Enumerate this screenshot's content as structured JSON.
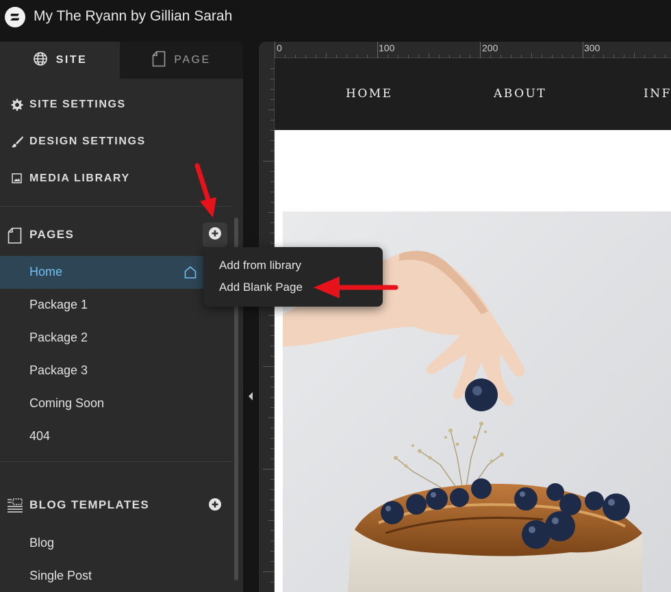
{
  "app": {
    "site_title": "My The Ryann by Gillian Sarah"
  },
  "sidebar": {
    "tabs": [
      {
        "label": "SITE",
        "icon": "globe-icon",
        "active": true
      },
      {
        "label": "PAGE",
        "icon": "page-icon",
        "active": false
      }
    ],
    "menu": [
      {
        "label": "SITE SETTINGS",
        "icon": "gear-icon"
      },
      {
        "label": "DESIGN SETTINGS",
        "icon": "brush-icon"
      },
      {
        "label": "MEDIA LIBRARY",
        "icon": "image-icon"
      }
    ],
    "pages_section": {
      "label": "PAGES",
      "items": [
        {
          "label": "Home",
          "active": true
        },
        {
          "label": "Package 1"
        },
        {
          "label": "Package 2"
        },
        {
          "label": "Package 3"
        },
        {
          "label": "Coming Soon"
        },
        {
          "label": "404"
        }
      ]
    },
    "blog_section": {
      "label": "BLOG TEMPLATES",
      "items": [
        {
          "label": "Blog"
        },
        {
          "label": "Single Post"
        }
      ]
    }
  },
  "add_page_menu": {
    "options": [
      {
        "label": "Add from library"
      },
      {
        "label": "Add Blank Page"
      }
    ]
  },
  "canvas": {
    "ruler_labels": [
      "0",
      "100",
      "200",
      "300"
    ],
    "site_nav": [
      "HOME",
      "ABOUT",
      "INF"
    ]
  },
  "colors": {
    "active_page_bg": "#2e4556",
    "active_page_text": "#6fc1f0",
    "annotation_arrow": "#e8121b"
  }
}
